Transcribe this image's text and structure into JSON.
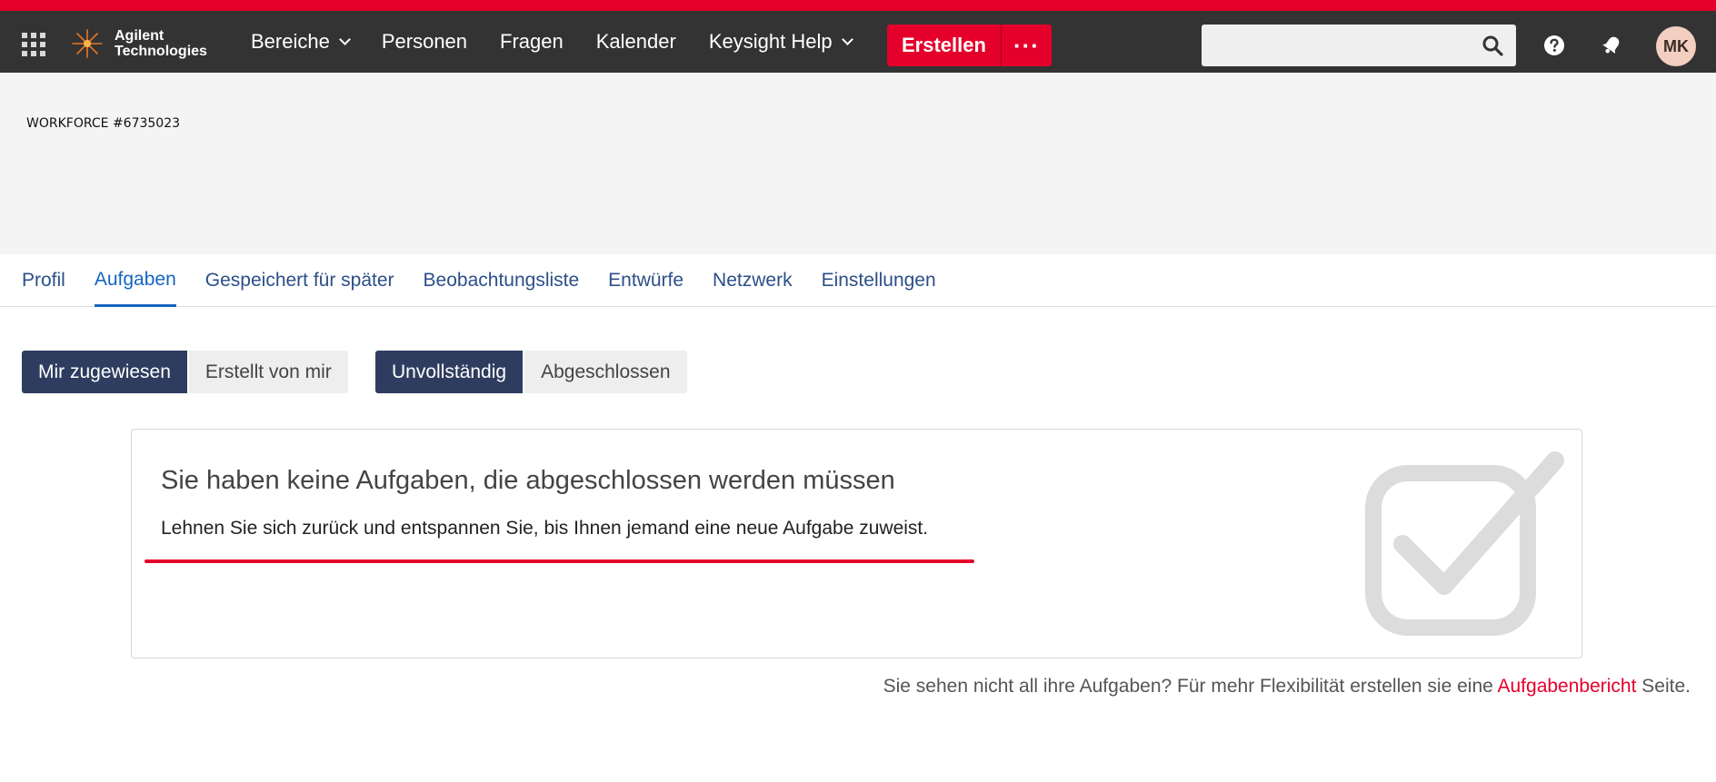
{
  "header": {
    "logo": {
      "line1": "Agilent",
      "line2": "Technologies"
    },
    "nav": [
      {
        "label": "Bereiche",
        "dropdown": true
      },
      {
        "label": "Personen",
        "dropdown": false
      },
      {
        "label": "Fragen",
        "dropdown": false
      },
      {
        "label": "Kalender",
        "dropdown": false
      },
      {
        "label": "Keysight Help",
        "dropdown": true
      }
    ],
    "create_label": "Erstellen",
    "more_label": "···",
    "search": {
      "placeholder": "",
      "value": ""
    },
    "avatar_initials": "MK"
  },
  "banner": {
    "title": "WORKFORCE #6735023"
  },
  "tabs": [
    {
      "label": "Profil",
      "active": false
    },
    {
      "label": "Aufgaben",
      "active": true
    },
    {
      "label": "Gespeichert für später",
      "active": false
    },
    {
      "label": "Beobachtungsliste",
      "active": false
    },
    {
      "label": "Entwürfe",
      "active": false
    },
    {
      "label": "Netzwerk",
      "active": false
    },
    {
      "label": "Einstellungen",
      "active": false
    }
  ],
  "filters": {
    "assignment": {
      "selected": "Mir zugewiesen",
      "other": "Erstellt von mir"
    },
    "status": {
      "selected": "Unvollständig",
      "other": "Abgeschlossen"
    }
  },
  "empty_state": {
    "title": "Sie haben keine Aufgaben, die abgeschlossen werden müssen",
    "subtitle": "Lehnen Sie sich zurück und entspannen Sie, bis Ihnen jemand eine neue Aufgabe zuweist."
  },
  "footer": {
    "text_before": "Sie sehen nicht all ihre Aufgaben? Für mehr Flexibilität erstellen sie eine ",
    "link": "Aufgabenbericht",
    "text_after": " Seite."
  },
  "colors": {
    "accent_red": "#e4002b",
    "topbar": "#333333",
    "active_tab": "#1565c0",
    "segment_on": "#2e3d5f"
  },
  "icons": [
    "app-launcher-icon",
    "agilent-spark-icon",
    "chevron-down-icon",
    "search-icon",
    "help-icon",
    "notification-icon",
    "checkbox-check-icon"
  ]
}
